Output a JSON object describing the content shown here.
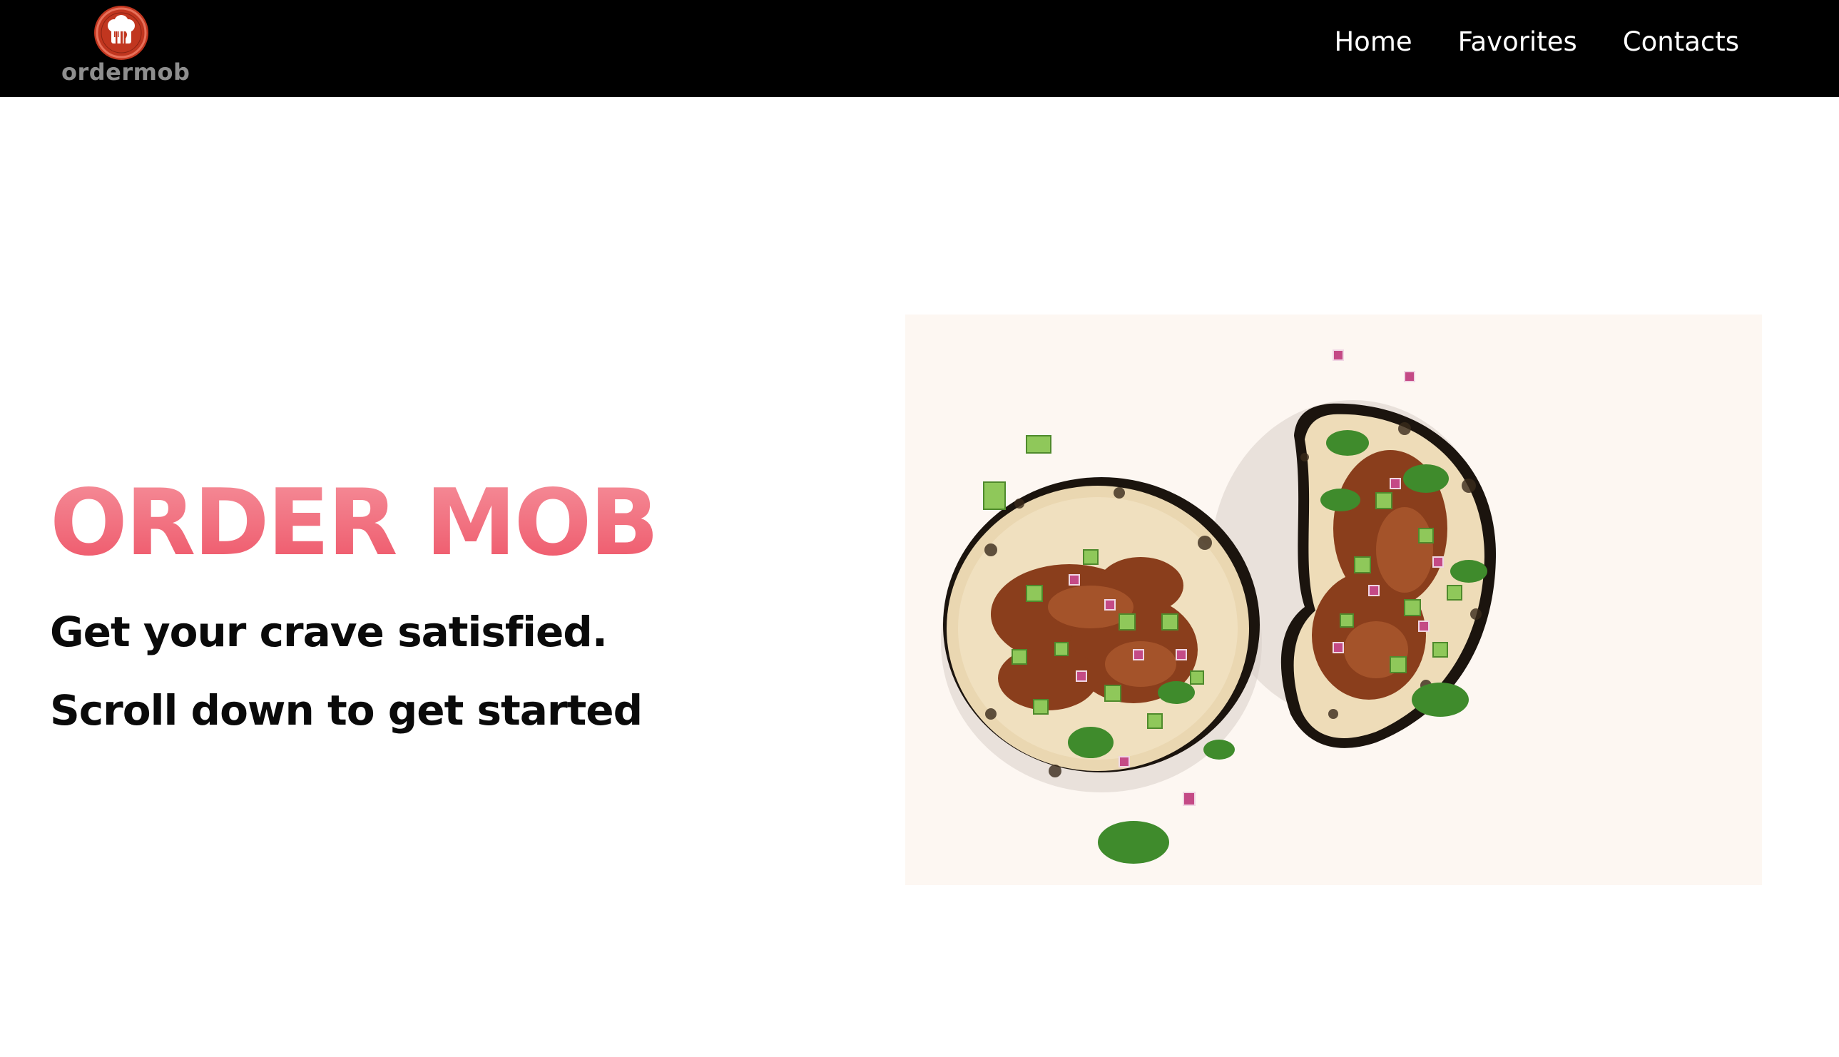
{
  "header": {
    "logo": {
      "icon": "chef-hat-utensils-icon",
      "wordmark": "ordermob",
      "badge_color": "#c1361f"
    },
    "nav": [
      {
        "label": "Home"
      },
      {
        "label": "Favorites"
      },
      {
        "label": "Contacts"
      }
    ],
    "background": "#000000"
  },
  "hero": {
    "title": "ORDER MOB",
    "title_gradient": [
      "#f58f9a",
      "#ee5467"
    ],
    "tagline": "Get your crave satisfied.",
    "cta_text": "Scroll down to get started",
    "image": {
      "subject": "tacos-illustration",
      "background": "#fdf7f2"
    }
  }
}
